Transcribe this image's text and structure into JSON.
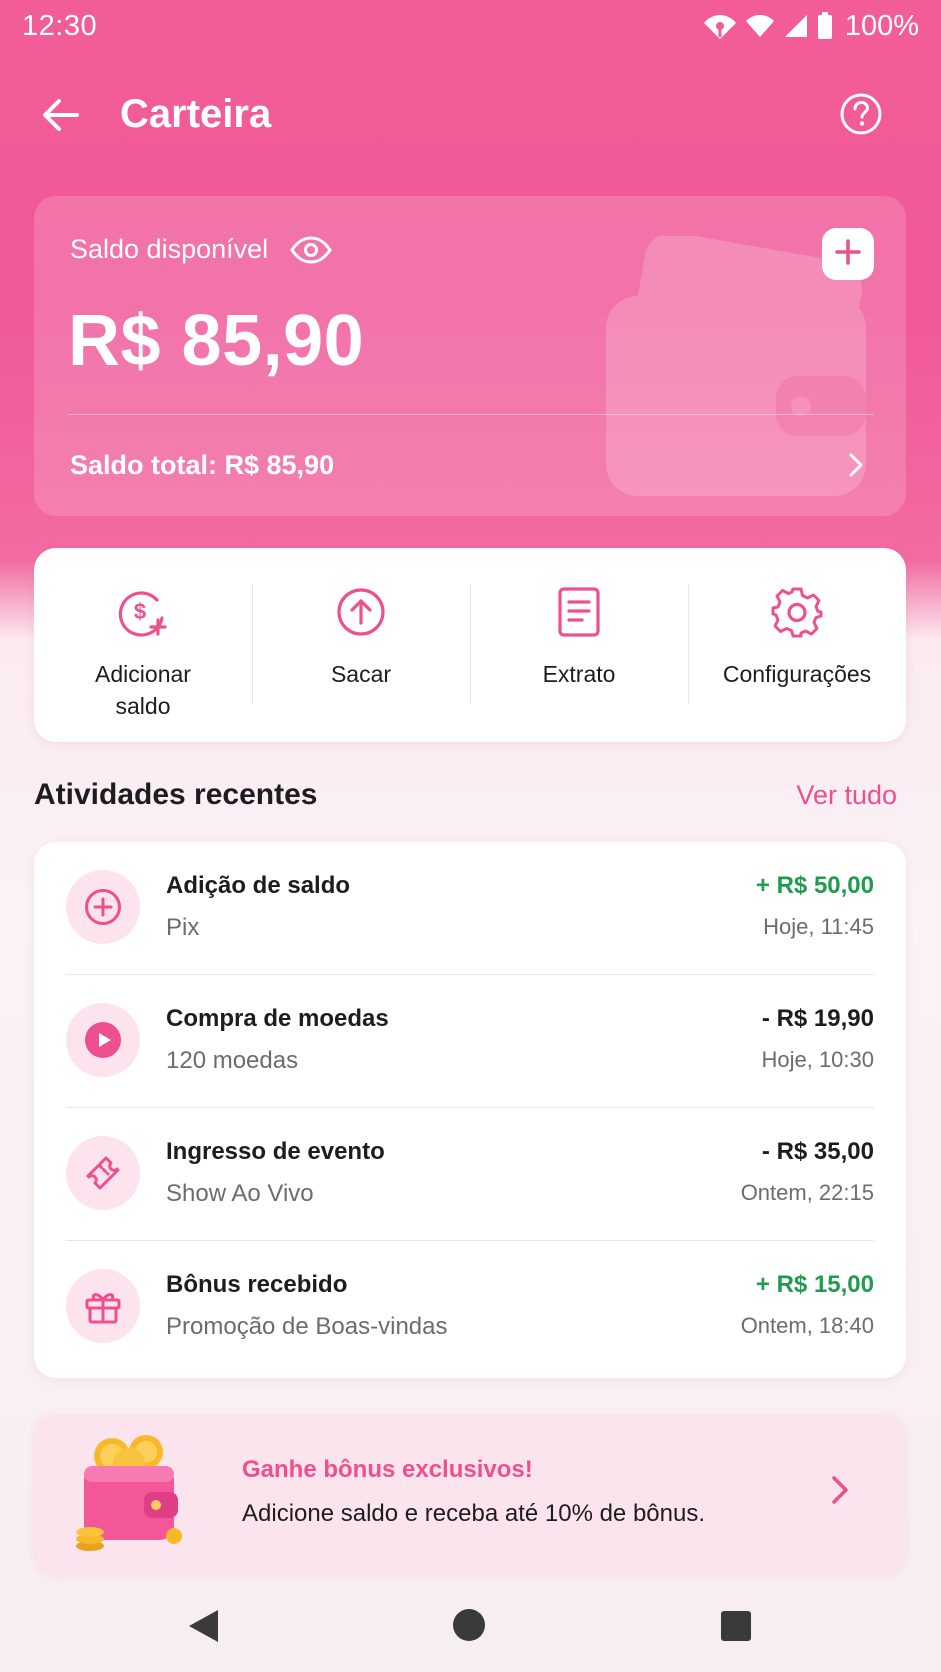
{
  "status_bar": {
    "time": "12:30",
    "battery": "100%"
  },
  "app_bar": {
    "title": "Carteira",
    "back_icon": "arrow-left-icon",
    "help_icon": "help-circle-icon"
  },
  "balance": {
    "label": "Saldo disponível",
    "value": "R$ 85,90",
    "total": "Saldo total: R$ 85,90"
  },
  "actions": [
    {
      "label": "Adicionar\nsaldo",
      "icon": "add-money-icon"
    },
    {
      "label": "Sacar",
      "icon": "withdraw-icon"
    },
    {
      "label": "Extrato",
      "icon": "statement-icon"
    },
    {
      "label": "Configurações",
      "icon": "gear-icon"
    }
  ],
  "activities": {
    "title": "Atividades recentes",
    "see_all": "Ver tudo",
    "items": [
      {
        "title": "Adição de saldo",
        "subtitle": "Pix",
        "amount": "+ R$ 50,00",
        "time": "Hoje, 11:45",
        "type": "positive",
        "icon": "plus-circle-icon"
      },
      {
        "title": "Compra de moedas",
        "subtitle": "120 moedas",
        "amount": "- R$ 19,90",
        "time": "Hoje, 10:30",
        "type": "negative",
        "icon": "play-icon"
      },
      {
        "title": "Ingresso de evento",
        "subtitle": "Show Ao Vivo",
        "amount": "- R$ 35,00",
        "time": "Ontem, 22:15",
        "type": "negative",
        "icon": "ticket-icon"
      },
      {
        "title": "Bônus recebido",
        "subtitle": "Promoção de Boas-vindas",
        "amount": "+ R$ 15,00",
        "time": "Ontem, 18:40",
        "type": "positive",
        "icon": "gift-icon"
      }
    ]
  },
  "promo": {
    "title": "Ganhe bônus exclusivos!",
    "text": "Adicione saldo e receba até 10% de bônus."
  },
  "colors": {
    "brand": "#f25d97",
    "accent": "#ee4f8e",
    "positive": "#1f9c4f"
  }
}
